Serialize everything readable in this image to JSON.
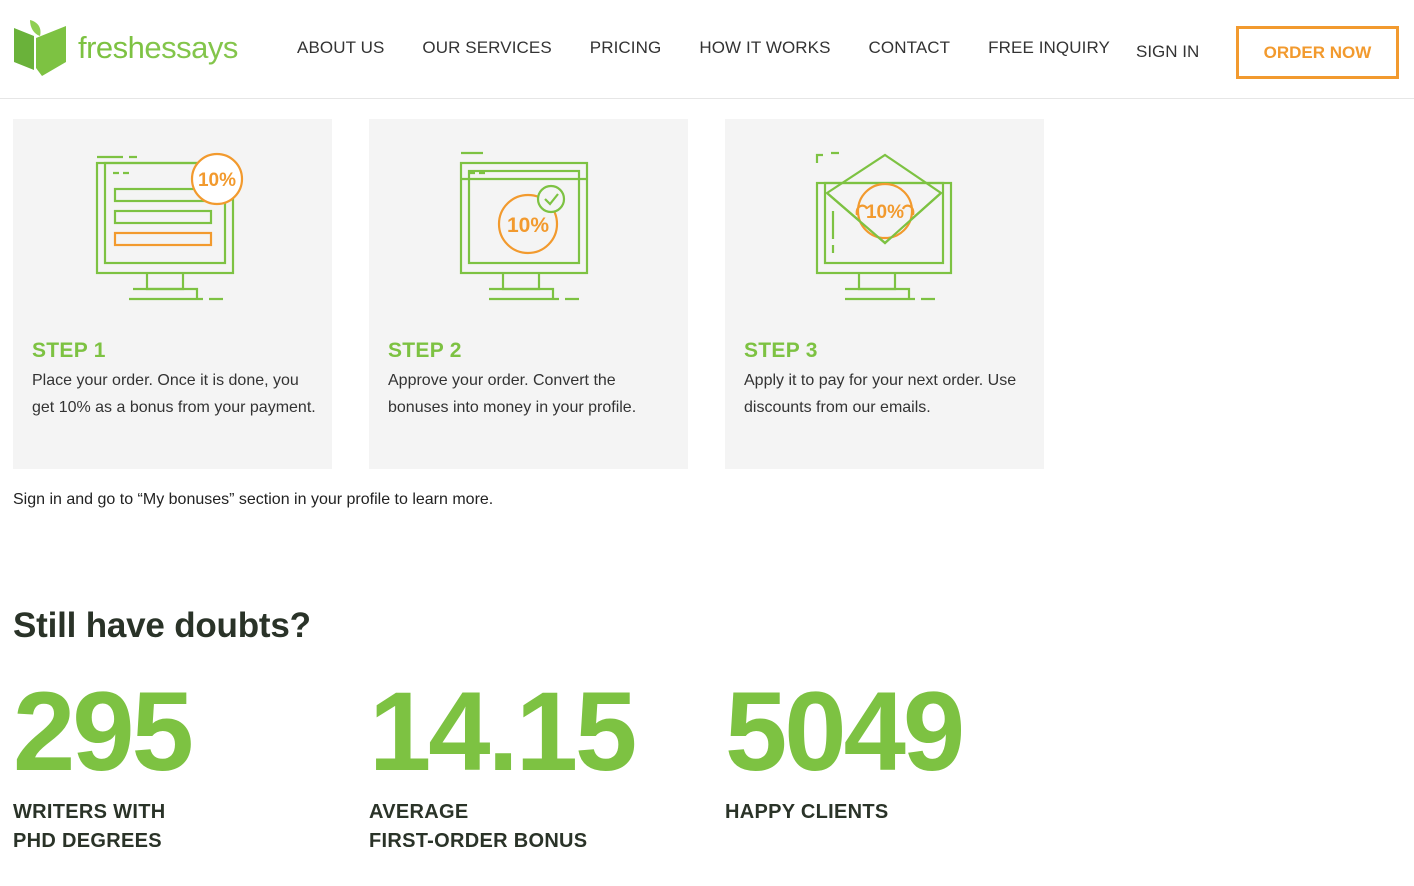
{
  "brand": {
    "fresh": "fresh",
    "essays": "essays",
    "color_green": "#7dc242",
    "color_orange": "#f29a2e"
  },
  "nav": {
    "items": [
      {
        "label": "ABOUT US"
      },
      {
        "label": "OUR SERVICES"
      },
      {
        "label": "PRICING"
      },
      {
        "label": "HOW IT WORKS"
      },
      {
        "label": "CONTACT"
      },
      {
        "label": "FREE INQUIRY"
      }
    ],
    "sign_in": "SIGN IN",
    "order_now": "ORDER NOW"
  },
  "steps": [
    {
      "title": "STEP 1",
      "badge": "10%",
      "icon": "monitor-form-icon",
      "desc": "Place your order. Once it is done, you get 10% as a bonus from your payment."
    },
    {
      "title": "STEP 2",
      "badge": "10%",
      "icon": "monitor-check-icon",
      "desc": "Approve your order. Convert the bonuses into money in your profile."
    },
    {
      "title": "STEP 3",
      "badge": "10%",
      "icon": "monitor-envelope-icon",
      "desc": "Apply it to pay for your next order. Use discounts from our emails."
    }
  ],
  "note": "Sign in and go to “My bonuses” section in your profile to learn more.",
  "doubts_title": "Still have doubts?",
  "stats": [
    {
      "number": "295",
      "line1": "WRITERS WITH",
      "line2": "PHD DEGREES"
    },
    {
      "number": "14.15",
      "line1": "AVERAGE",
      "line2": "FIRST-ORDER BONUS"
    },
    {
      "number": "5049",
      "line1": "HAPPY CLIENTS",
      "line2": ""
    }
  ]
}
